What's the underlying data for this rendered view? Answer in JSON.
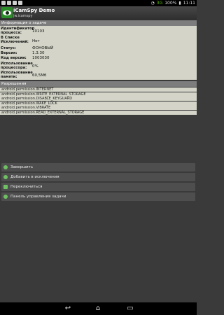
{
  "status_bar": {
    "network": "3G",
    "battery": "100%",
    "time": "11:11"
  },
  "app": {
    "title": "iCamSpy Demo",
    "subtitle": "jw.icamspy"
  },
  "info_section": {
    "header": "Информация о задаче",
    "rows": [
      {
        "label": "Идентификатор процесса:",
        "value": "10103"
      },
      {
        "label": "В Списке Исключений:",
        "value": "Нет"
      },
      {
        "label": "Статус:",
        "value": "ФОНОВЫЙ"
      },
      {
        "label": "Версия:",
        "value": "1.3.30"
      },
      {
        "label": "Код версии:",
        "value": "1003030"
      },
      {
        "label": "Использование процессора:",
        "value": "0%"
      },
      {
        "label": "Использование памяти:",
        "value": "60,5Мб"
      }
    ]
  },
  "permissions": {
    "header": "Разрешения",
    "items": [
      "android.permission.INTERNET",
      "android.permission.WRITE_EXTERNAL_STORAGE",
      "android.permission.DISABLE_KEYGUARD",
      "android.permission.WAKE_LOCK",
      "android.permission.VIBRATE",
      "android.permission.READ_EXTERNAL_STORAGE"
    ]
  },
  "actions": [
    {
      "label": "Завершить",
      "icon": "power-icon"
    },
    {
      "label": "Добавить в исключения",
      "icon": "add-exclusion-icon"
    },
    {
      "label": "Переключиться",
      "icon": "switch-icon"
    },
    {
      "label": "Панель управления задачи",
      "icon": "control-panel-icon"
    }
  ],
  "nav": {
    "back": "back-icon",
    "home": "home-icon",
    "recents": "recents-icon"
  }
}
